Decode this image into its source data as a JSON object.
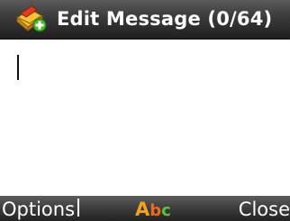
{
  "header": {
    "title": "Edit Message (0/64)",
    "icon": "message-edit-icon"
  },
  "editor": {
    "text": ""
  },
  "softkeys": {
    "left_label": "Options",
    "right_label": "Close"
  },
  "input_mode": {
    "chars": [
      "A",
      "b",
      "c"
    ],
    "colors": [
      "#f2a21c",
      "#f06a1c",
      "#5cc23a"
    ]
  }
}
